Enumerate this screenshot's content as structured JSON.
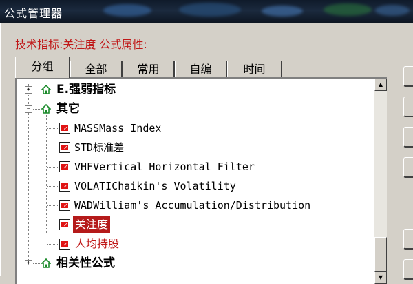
{
  "window": {
    "title": "公式管理器"
  },
  "info": {
    "text": "技术指标:关注度 公式属性:"
  },
  "tabs": [
    {
      "label": "分组",
      "active": true
    },
    {
      "label": "全部",
      "active": false
    },
    {
      "label": "常用",
      "active": false
    },
    {
      "label": "自编",
      "active": false
    },
    {
      "label": "时间",
      "active": false
    }
  ],
  "tree": {
    "groups": [
      {
        "label": "E.强弱指标",
        "expander": "+",
        "icon": "house-icon"
      },
      {
        "label": "其它",
        "expander": "−",
        "icon": "house-icon"
      },
      {
        "label": "相关性公式",
        "expander": "+",
        "icon": "house-icon"
      }
    ],
    "items": [
      {
        "label": "MASSMass Index",
        "icon": "formula-icon"
      },
      {
        "label": "STD标准差",
        "icon": "formula-icon"
      },
      {
        "label": "VHFVertical Horizontal Filter",
        "icon": "formula-icon"
      },
      {
        "label": "VOLATIChaikin's Volatility",
        "icon": "formula-icon"
      },
      {
        "label": "WADWilliam's Accumulation/Distribution",
        "icon": "formula-icon"
      },
      {
        "label": "关注度",
        "icon": "formula-icon",
        "selected": true
      },
      {
        "label": "人均持股",
        "icon": "formula-icon"
      }
    ]
  },
  "colors": {
    "accent": "#c01818",
    "selected_bg": "#b51a1a",
    "icon_green": "#1a8a2a"
  }
}
